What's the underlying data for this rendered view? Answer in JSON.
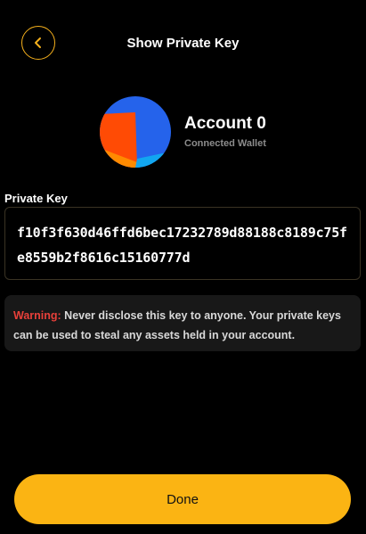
{
  "header": {
    "title": "Show Private Key",
    "back_icon": "chevron-left-icon"
  },
  "account": {
    "name": "Account 0",
    "subtitle": "Connected Wallet",
    "avatar_colors": [
      "#2563eb",
      "#ff4b05",
      "#ff8a00",
      "#12a6f0"
    ]
  },
  "private_key": {
    "label": "Private Key",
    "value": "f10f3f630d46ffd6bec17232789d88188c8189c75fe8559b2f8616c15160777d"
  },
  "warning": {
    "label": "Warning:",
    "message": " Never disclose this key to anyone. Your private keys can be used to steal any assets held in your account."
  },
  "actions": {
    "done_label": "Done"
  },
  "colors": {
    "accent": "#fbb413",
    "warning": "#e8403a",
    "background": "#000000"
  }
}
